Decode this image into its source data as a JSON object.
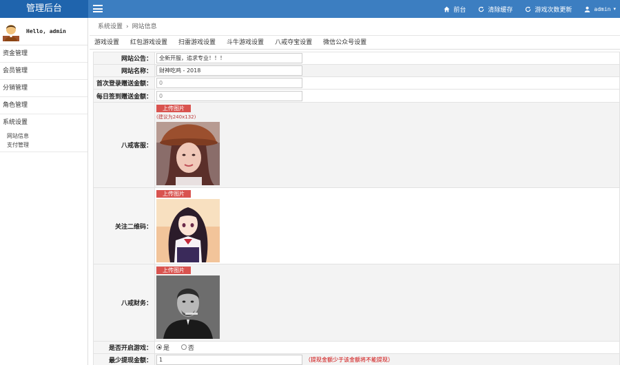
{
  "header": {
    "brand": "管理后台",
    "nav": [
      {
        "icon": "home-icon",
        "label": "前台"
      },
      {
        "icon": "refresh-icon",
        "label": "清除缓存"
      },
      {
        "icon": "refresh-icon",
        "label": "游戏次数更新"
      },
      {
        "icon": "user-icon",
        "label": "admin"
      }
    ]
  },
  "sidebar": {
    "greeting": "Hello, admin",
    "items": [
      "资金管理",
      "会员管理",
      "分销管理",
      "角色管理",
      "系统设置"
    ],
    "subitems": [
      "网站信息",
      "支付管理"
    ]
  },
  "breadcrumb": {
    "parent": "系统设置",
    "sep": "›",
    "current": "网站信息"
  },
  "tabs": [
    "游戏设置",
    "红包游戏设置",
    "扫雷游戏设置",
    "斗牛游戏设置",
    "八戒夺宝设置",
    "微信公众号设置"
  ],
  "form": {
    "notice": {
      "label": "网站公告：",
      "value": "全新开服，追求专业！！！"
    },
    "site_name": {
      "label": "网站名称：",
      "value": "财神吃鸡 - 2018"
    },
    "first_login": {
      "label": "首次登录赠送金额：",
      "value": "0"
    },
    "daily_sign": {
      "label": "每日签到赠送金额：",
      "value": "0"
    },
    "upload_label": "上传图片",
    "upload_hint": "(建议为240x132)",
    "cs": {
      "label": "八戒客服："
    },
    "qrcode": {
      "label": "关注二维码："
    },
    "finance": {
      "label": "八戒财务："
    },
    "game_open": {
      "label": "是否开启游戏：",
      "yes": "是",
      "no": "否"
    },
    "min_withdraw": {
      "label": "最少提现金额：",
      "value": "1",
      "warning": "（提现金额少于该金额将不能提现）"
    }
  },
  "colors": {
    "topbar": "#3c7ec1",
    "brand": "#1f64ad",
    "upload_button": "#d9534f"
  }
}
